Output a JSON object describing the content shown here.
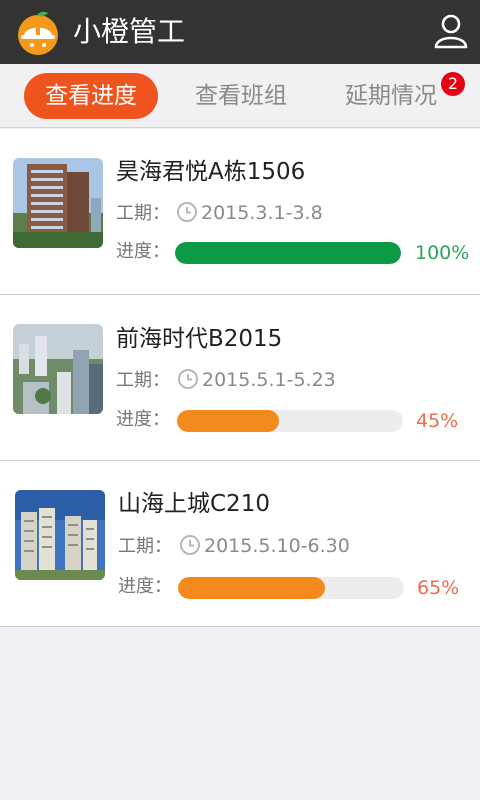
{
  "app": {
    "title": "小橙管工",
    "accent": "#f0541e",
    "header_bg": "#333333"
  },
  "header": {
    "user_icon": "user-icon",
    "logo_icon": "orange-helmet-logo"
  },
  "tabs": [
    {
      "label": "查看进度",
      "active": true
    },
    {
      "label": "查看班组",
      "active": false
    },
    {
      "label": "延期情况",
      "active": false,
      "badge": "2"
    }
  ],
  "projects": [
    {
      "name": "昊海君悦A栋1506",
      "period_label": "工期：",
      "period": "2015.3.1-3.8",
      "progress_label": "进度：",
      "progress": 100,
      "progress_text": "100%",
      "bar_color": "#0b9b45",
      "text_color": "#2ca55a"
    },
    {
      "name": "前海时代B2015",
      "period_label": "工期：",
      "period": "2015.5.1-5.23",
      "progress_label": "进度：",
      "progress": 45,
      "progress_text": "45%",
      "bar_color": "#f28a1e",
      "text_color": "#ee6b4a"
    },
    {
      "name": "山海上城C210",
      "period_label": "工期：",
      "period": "2015.5.10-6.30",
      "progress_label": "进度：",
      "progress": 65,
      "progress_text": "65%",
      "bar_color": "#f28a1e",
      "text_color": "#ee6b4a"
    }
  ]
}
